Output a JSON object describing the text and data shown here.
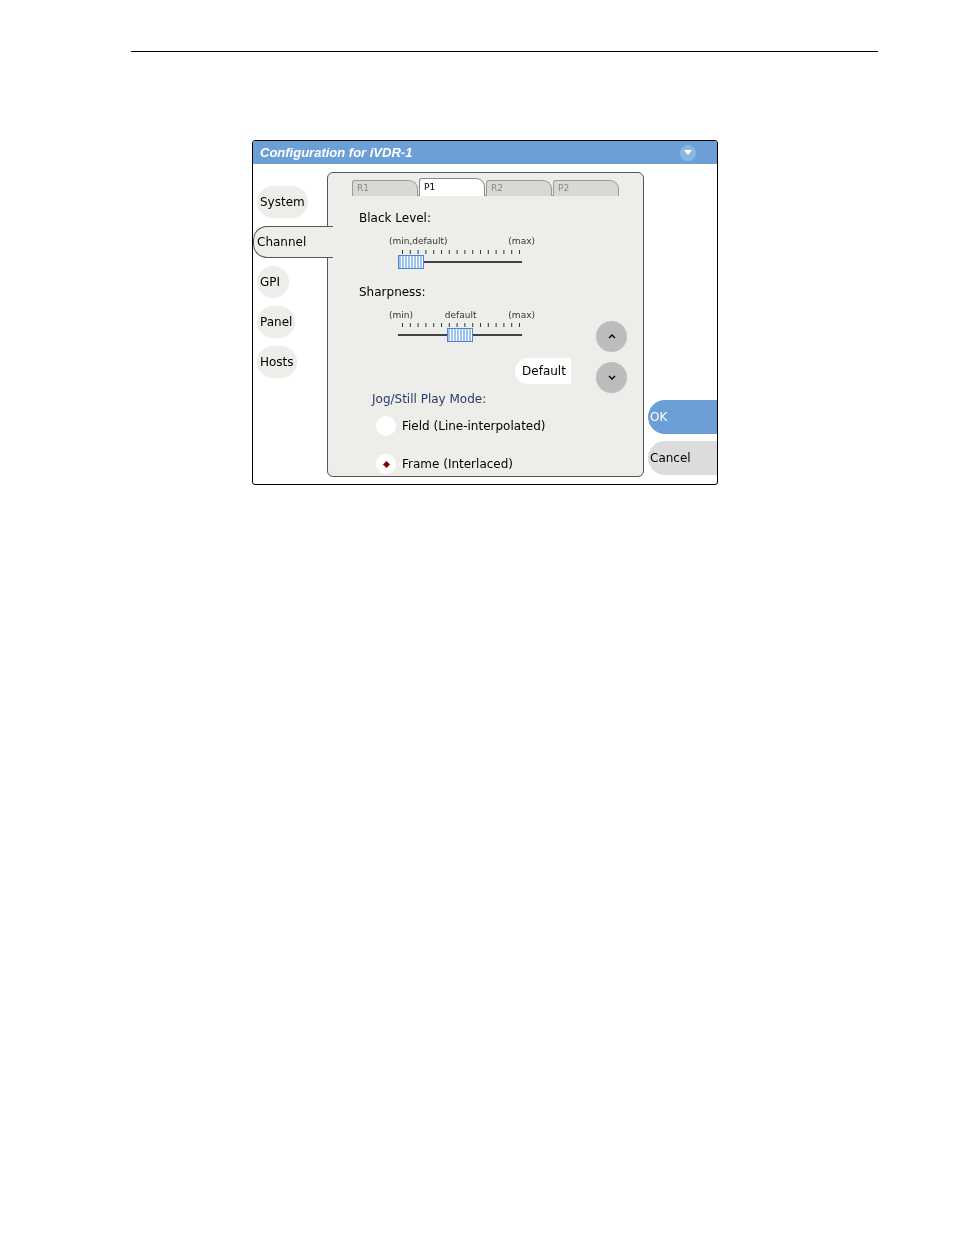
{
  "window": {
    "title": "Configuration for iVDR-1"
  },
  "sidebar": {
    "items": [
      {
        "label": "System",
        "selected": false
      },
      {
        "label": "Channel",
        "selected": true
      },
      {
        "label": "GPI",
        "selected": false
      },
      {
        "label": "Panel",
        "selected": false
      },
      {
        "label": "Hosts",
        "selected": false
      }
    ]
  },
  "tabs": [
    {
      "label": "R1",
      "selected": false
    },
    {
      "label": "P1",
      "selected": true
    },
    {
      "label": "R2",
      "selected": false
    },
    {
      "label": "P2",
      "selected": false
    }
  ],
  "sliders": [
    {
      "label": "Black Level:",
      "scale_labels": [
        "(min,default)",
        "(max)"
      ],
      "level": 0
    },
    {
      "label": "Sharpness:",
      "scale_labels": [
        "(min)",
        "default",
        "(max)"
      ],
      "level": 0.5
    }
  ],
  "default_button": "Default",
  "jog_mode": {
    "label": "Jog/Still Play Mode:",
    "options": [
      {
        "label": "Field (Line-interpolated)",
        "selected": false
      },
      {
        "label": "Frame (Interlaced)",
        "selected": true
      }
    ]
  },
  "buttons": [
    {
      "label": "OK",
      "kind": "primary"
    },
    {
      "label": "Cancel",
      "kind": "secondary"
    }
  ]
}
